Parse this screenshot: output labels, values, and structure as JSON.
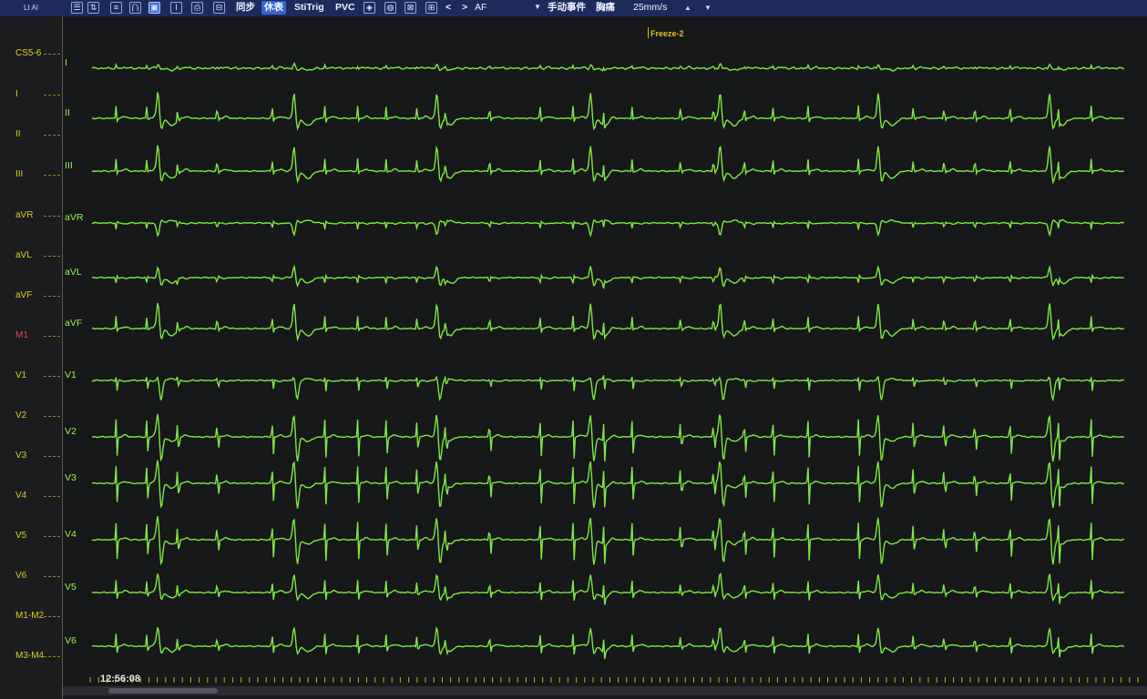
{
  "toolbar": {
    "top_left": "Lt  AI",
    "sync_label": "同步",
    "rest_label": "休表",
    "stitrig_label": "StiTrig",
    "pvc_label": "PVC",
    "prev_label": "<",
    "next_label": ">",
    "rhythm_label": "AF",
    "manual_event_label": "手动事件",
    "extra_label": "胸痛",
    "speed_label": "25mm/s",
    "up_label": "▲",
    "down_label": "▼"
  },
  "left_labels": [
    "CS5-6",
    "I",
    "II",
    "III",
    "aVR",
    "aVL",
    "aVF",
    "M1",
    "V1",
    "V2",
    "V3",
    "V4",
    "V5",
    "V6",
    "M1-M2",
    "M3-M4"
  ],
  "traces": [
    {
      "label": "I",
      "type": "lead_I"
    },
    {
      "label": "II",
      "type": "inferior"
    },
    {
      "label": "III",
      "type": "inferior"
    },
    {
      "label": "aVR",
      "type": "avr"
    },
    {
      "label": "aVL",
      "type": "avl"
    },
    {
      "label": "aVF",
      "type": "inferior"
    },
    {
      "label": "V1",
      "type": "v1"
    },
    {
      "label": "V2",
      "type": "precordial"
    },
    {
      "label": "V3",
      "type": "precordial"
    },
    {
      "label": "V4",
      "type": "precordial"
    },
    {
      "label": "V5",
      "type": "lateral"
    },
    {
      "label": "V6",
      "type": "lateral"
    }
  ],
  "beats": {
    "narrow_times_s": [
      0.55,
      1.25,
      1.95,
      2.85,
      4.1,
      5.3,
      6.05,
      6.7,
      7.4,
      8.05,
      9.05,
      10.2,
      10.95,
      11.65,
      12.3,
      13.4,
      14.15,
      14.85,
      15.5,
      16.3,
      17.45,
      18.7,
      19.4,
      20.1,
      20.9,
      22.0,
      22.75
    ],
    "wide_times_s": [
      1.5,
      4.6,
      7.85,
      11.35,
      14.3,
      17.9,
      21.8
    ]
  },
  "freeze_label": "Freeze-2",
  "time_label": "12:56:08",
  "colors": {
    "trace": "#7fe845",
    "label_left": "#d8ce2a",
    "label_marker": "#e2474d",
    "toolbar_bg": "#1c2b5c"
  }
}
